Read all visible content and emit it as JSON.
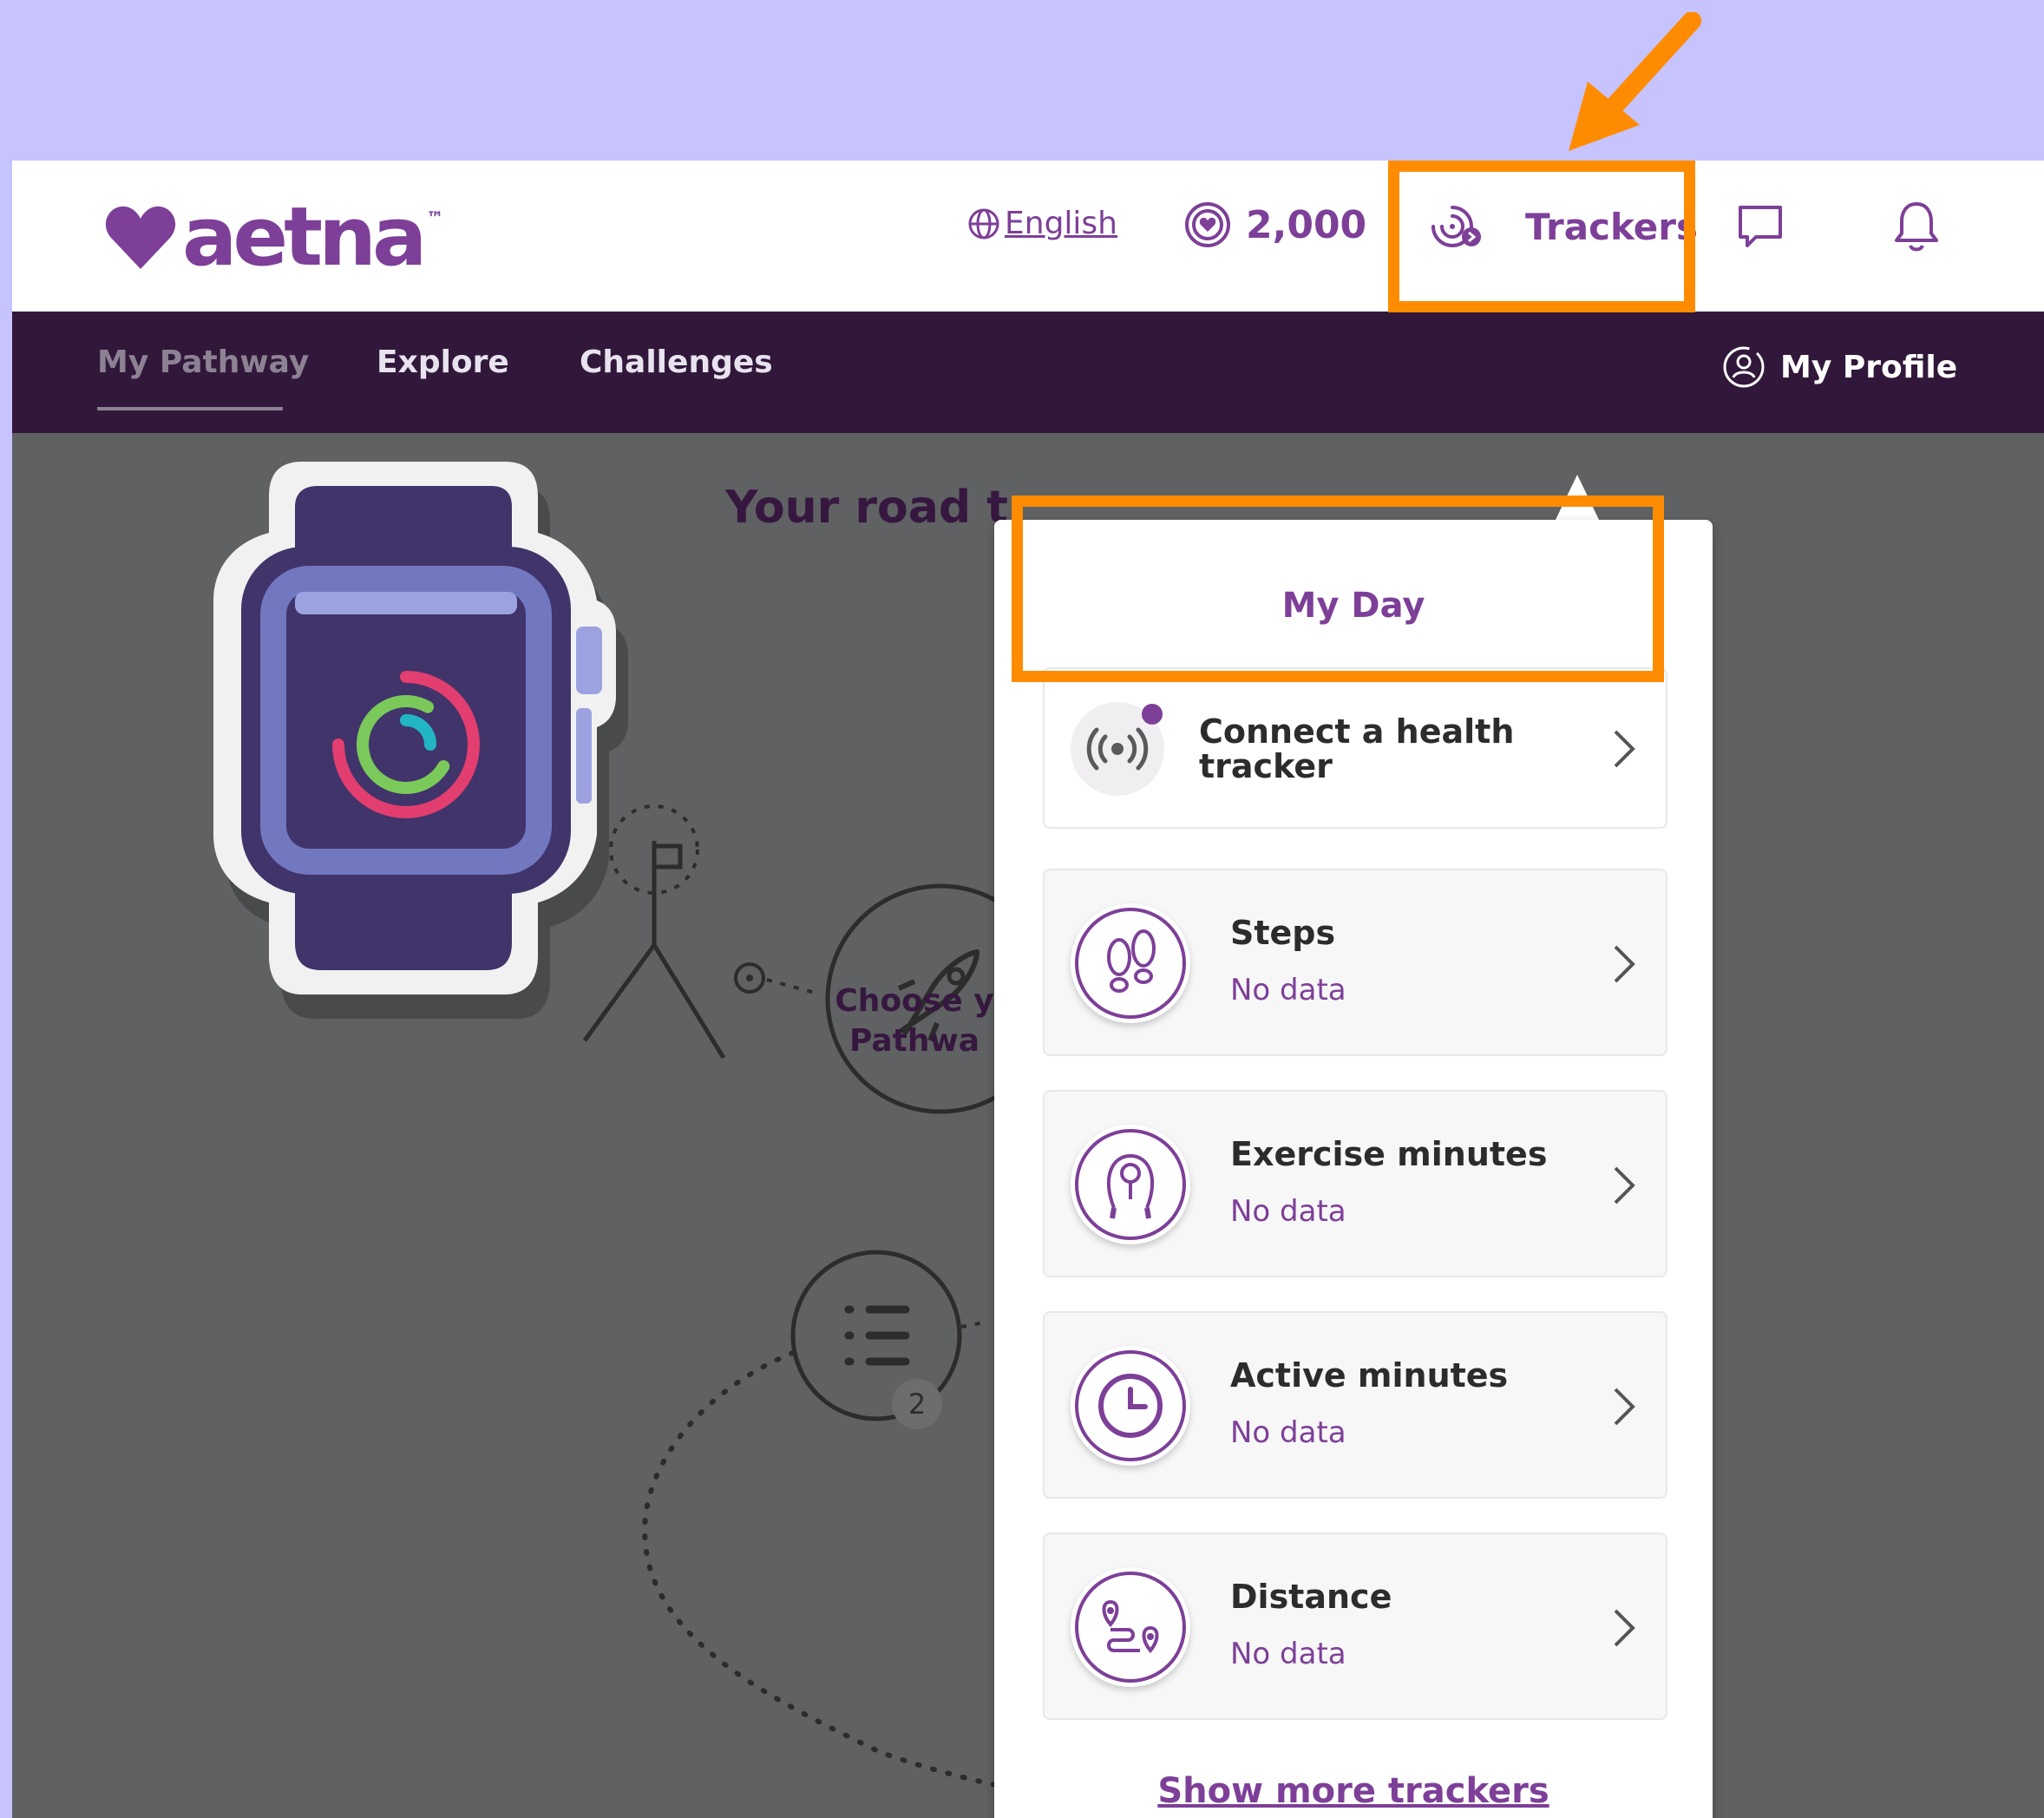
{
  "header": {
    "logo_text": "aetna",
    "logo_tm": "™",
    "language": "English",
    "points": "2,000",
    "trackers_label": "Trackers"
  },
  "nav": {
    "items": [
      {
        "label": "My Pathway",
        "active": true
      },
      {
        "label": "Explore",
        "active": false
      },
      {
        "label": "Challenges",
        "active": false
      }
    ],
    "profile_label": "My Profile"
  },
  "background": {
    "heading": "Your road t",
    "choose_label_line1": "Choose y",
    "choose_label_line2": "Pathwa",
    "step_number": "2"
  },
  "trackers_panel": {
    "title": "My Day",
    "connect_label": "Connect a health tracker",
    "trackers": [
      {
        "name": "Steps",
        "value": "No data",
        "icon": "footprints-icon"
      },
      {
        "name": "Exercise minutes",
        "value": "No data",
        "icon": "jump-rope-icon"
      },
      {
        "name": "Active minutes",
        "value": "No data",
        "icon": "clock-icon"
      },
      {
        "name": "Distance",
        "value": "No data",
        "icon": "route-icon"
      }
    ],
    "show_more": "Show more trackers"
  },
  "colors": {
    "brand": "#7d3f98",
    "nav_bg": "#31183a",
    "highlight": "#ff8c00",
    "page_bg": "#c7c3fd"
  }
}
